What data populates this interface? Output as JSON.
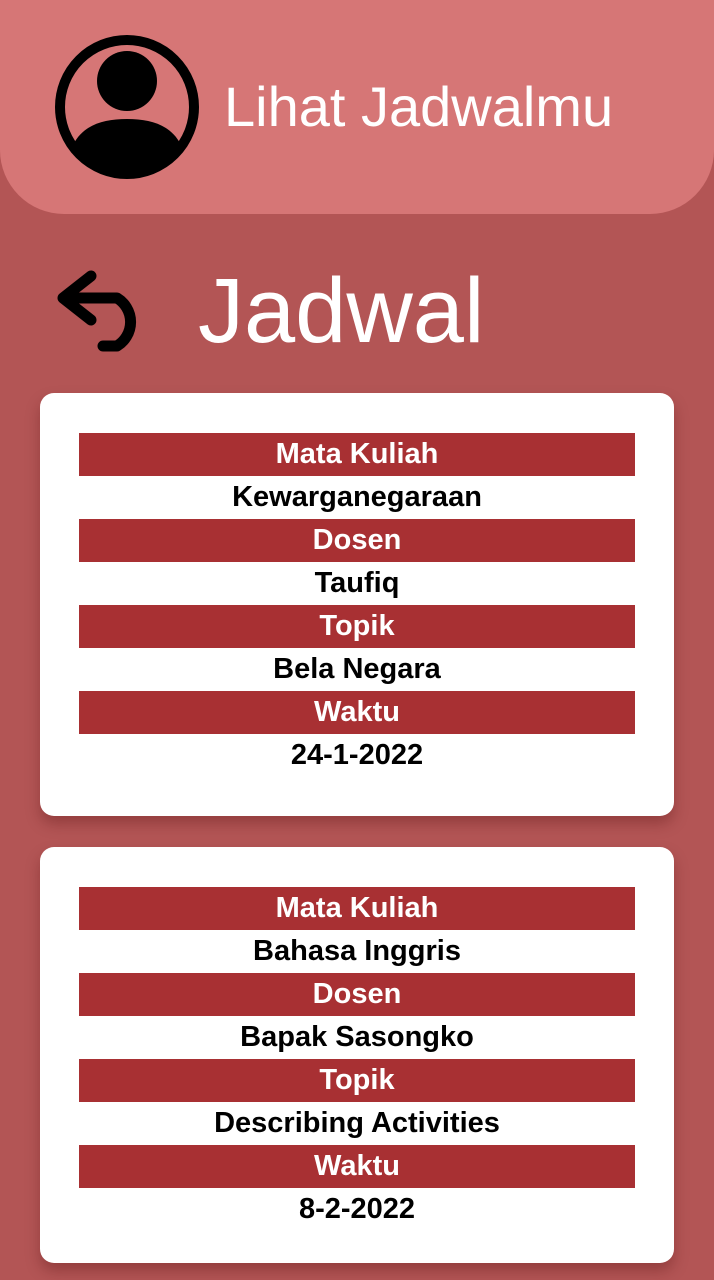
{
  "header": {
    "title": "Lihat Jadwalmu",
    "avatar_icon": "user-avatar-icon"
  },
  "page": {
    "title": "Jadwal",
    "back_icon": "undo-arrow-icon"
  },
  "labels": {
    "course": "Mata Kuliah",
    "lecturer": "Dosen",
    "topic": "Topik",
    "time": "Waktu"
  },
  "schedules": [
    {
      "course": "Kewarganegaraan",
      "lecturer": "Taufiq",
      "topic": "Bela Negara",
      "time": "24-1-2022"
    },
    {
      "course": "Bahasa Inggris",
      "lecturer": "Bapak Sasongko",
      "topic": "Describing Activities",
      "time": "8-2-2022"
    }
  ],
  "colors": {
    "background": "#b35555",
    "header": "#d67676",
    "label_band": "#a83033",
    "card": "#ffffff"
  }
}
